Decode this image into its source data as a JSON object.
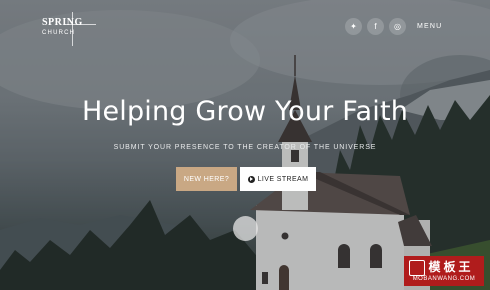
{
  "header": {
    "logo_line1": "SPRING",
    "logo_line2": "CHURCH",
    "social": [
      {
        "icon": "twitter-icon",
        "glyph": "✦"
      },
      {
        "icon": "facebook-icon",
        "glyph": "f"
      },
      {
        "icon": "instagram-icon",
        "glyph": "◎"
      }
    ],
    "menu_label": "MENU"
  },
  "hero": {
    "title": "Helping Grow Your Faith",
    "subtitle": "SUBMIT YOUR PRESENCE TO THE CREATOR OF THE UNIVERSE",
    "button_new": "NEW HERE?",
    "button_live": "LIVE STREAM"
  },
  "watermark": {
    "title": "模板王",
    "url": "MOBANWANG.COM"
  },
  "colors": {
    "accent": "#c9a884",
    "watermark": "#b01c1c"
  }
}
